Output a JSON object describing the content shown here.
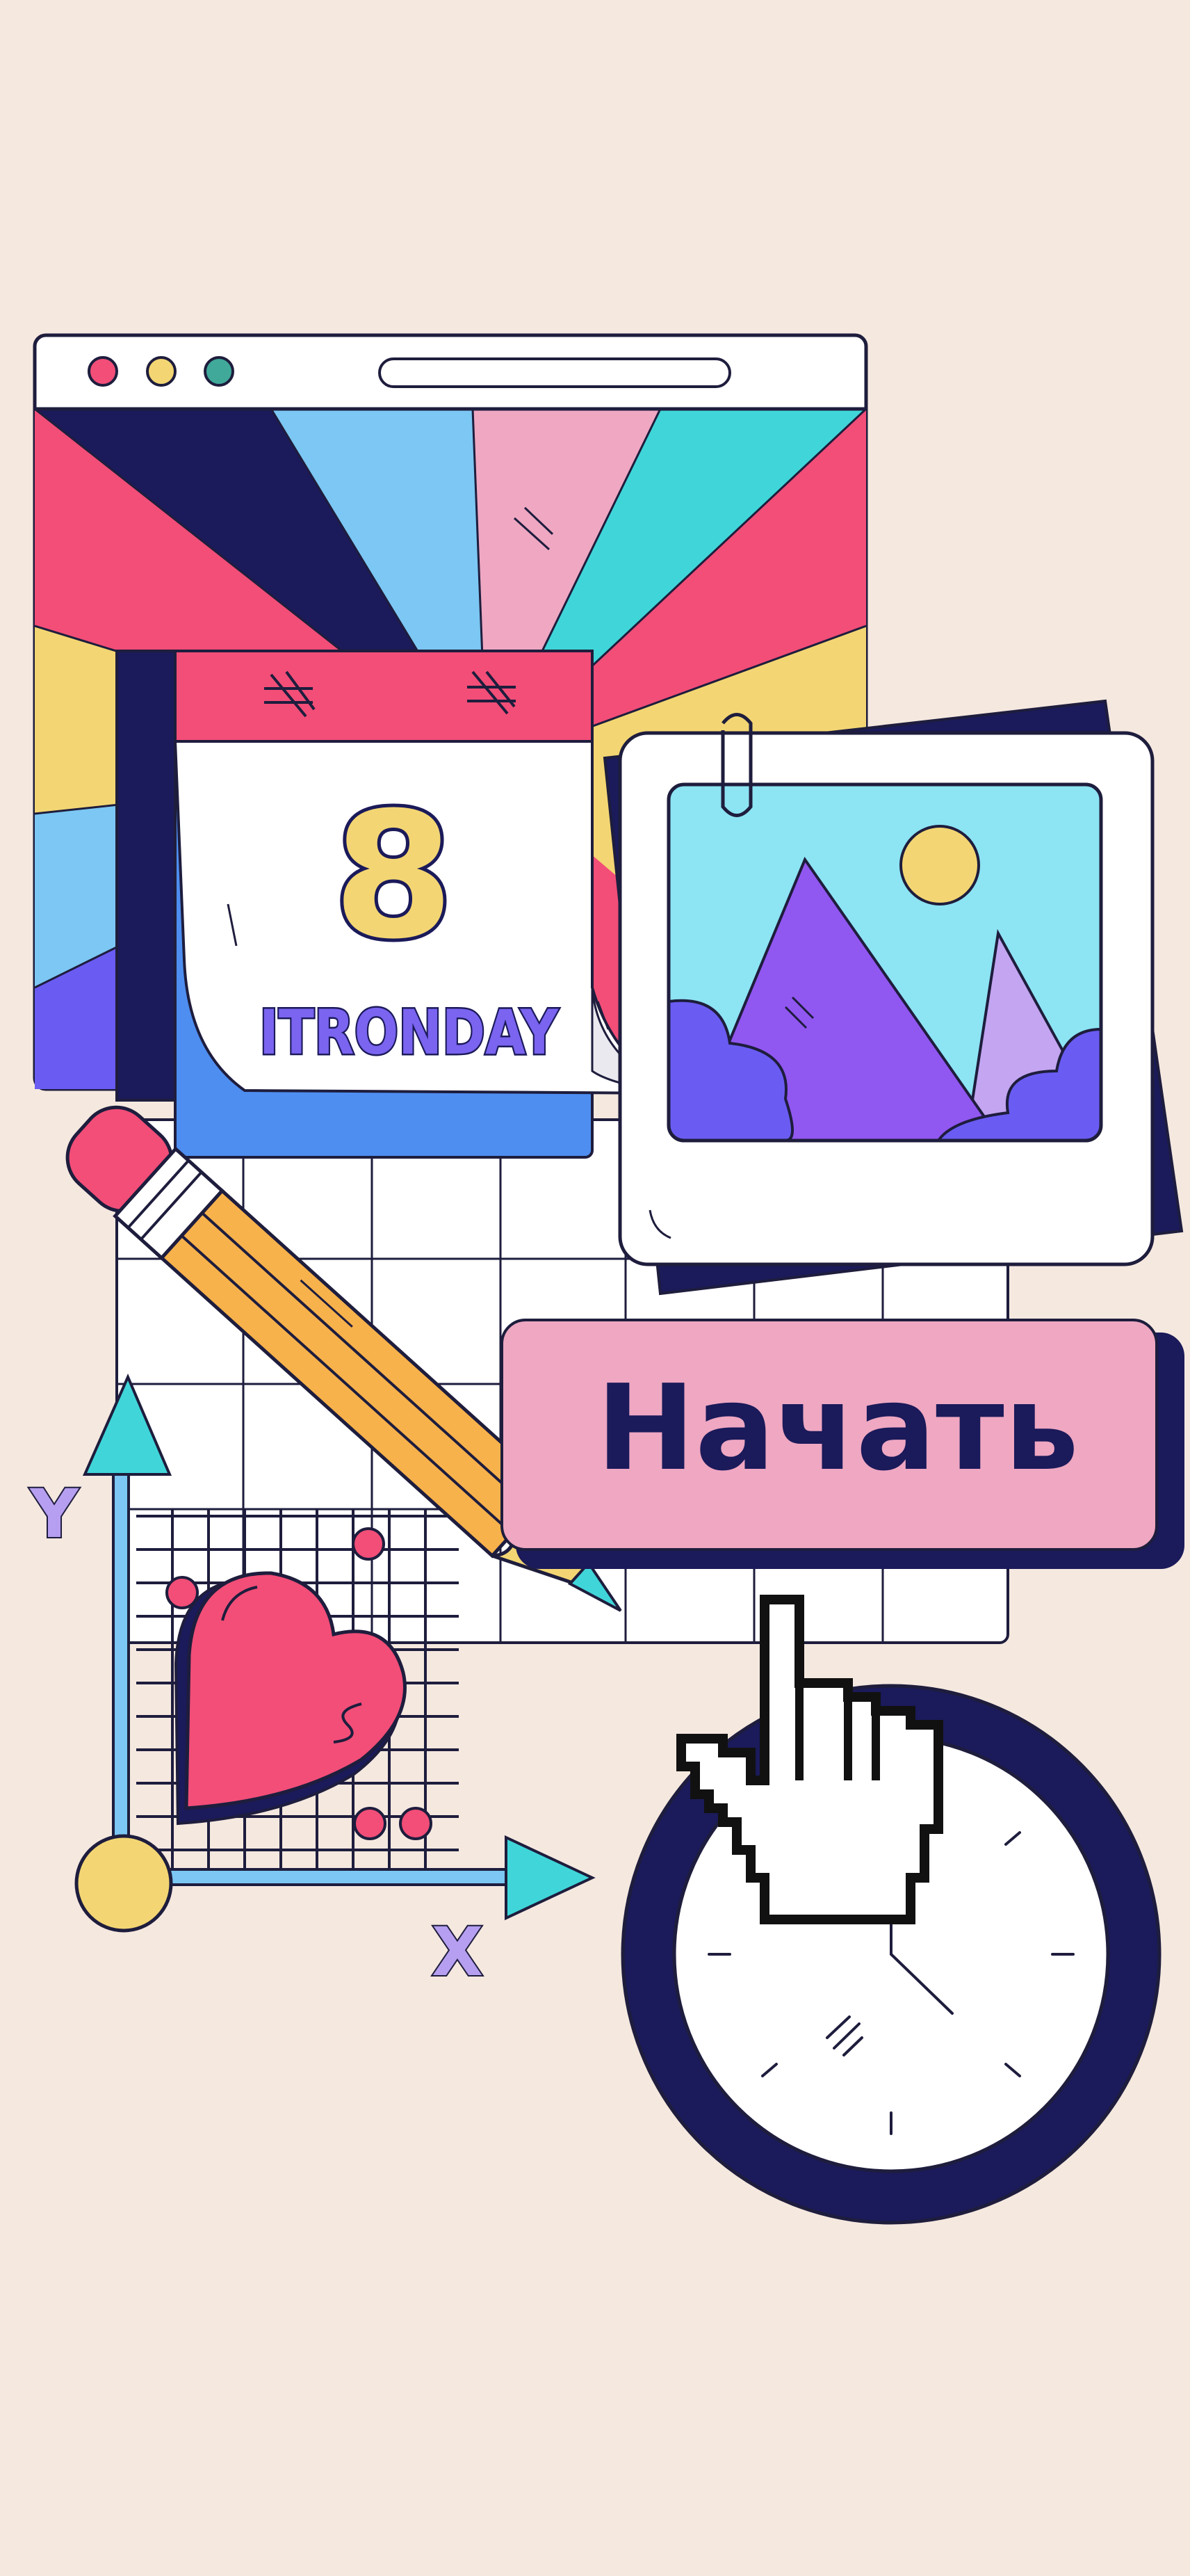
{
  "start_button": {
    "label": "Начать"
  },
  "calendar": {
    "day_number": "8",
    "weekday": "ITRONDAY"
  },
  "graph": {
    "x_label": "X",
    "y_label": "Y"
  },
  "colors": {
    "background": "#f5e8df",
    "navy": "#1b1a5a",
    "pink": "#f24e78",
    "light_pink": "#efa7c2",
    "yellow": "#f3d673",
    "sky": "#7cc7f3",
    "teal": "#40d6d9",
    "purple": "#9157f1",
    "lavender": "#c3a5f1",
    "orange": "#f8b24c",
    "blue": "#4e8ef1"
  },
  "icons": [
    "browser-window",
    "calendar-icon",
    "photo-frame-icon",
    "pencil-icon",
    "graph-axes-icon",
    "heart-icon",
    "clock-icon",
    "hand-cursor-icon"
  ]
}
